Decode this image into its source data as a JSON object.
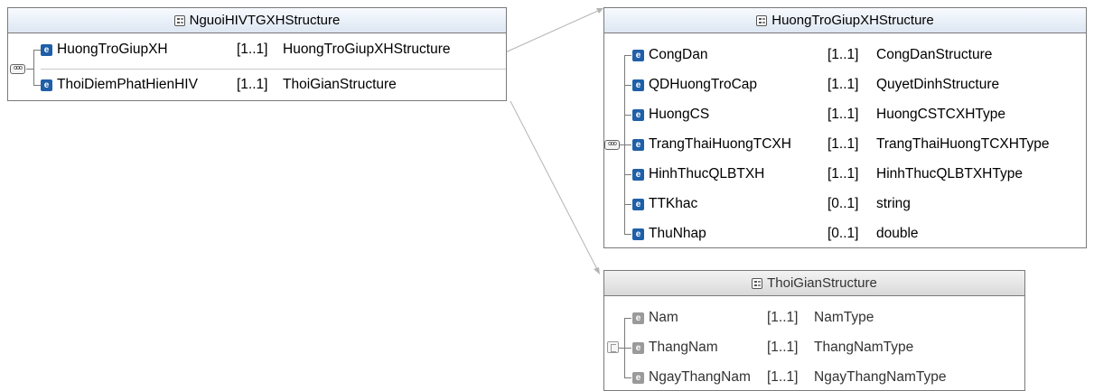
{
  "structures": {
    "nguoi": {
      "title": "NguoiHIVTGXHStructure",
      "rows": [
        {
          "name": "HuongTroGiupXH",
          "card": "[1..1]",
          "type": "HuongTroGiupXHStructure"
        },
        {
          "name": "ThoiDiemPhatHienHIV",
          "card": "[1..1]",
          "type": "ThoiGianStructure"
        }
      ]
    },
    "huong": {
      "title": "HuongTroGiupXHStructure",
      "rows": [
        {
          "name": "CongDan",
          "card": "[1..1]",
          "type": "CongDanStructure"
        },
        {
          "name": "QDHuongTroCap",
          "card": "[1..1]",
          "type": "QuyetDinhStructure"
        },
        {
          "name": "HuongCS",
          "card": "[1..1]",
          "type": "HuongCSTCXHType"
        },
        {
          "name": "TrangThaiHuongTCXH",
          "card": "[1..1]",
          "type": "TrangThaiHuongTCXHType"
        },
        {
          "name": "HinhThucQLBTXH",
          "card": "[1..1]",
          "type": "HinhThucQLBTXHType"
        },
        {
          "name": "TTKhac",
          "card": "[0..1]",
          "type": "string"
        },
        {
          "name": "ThuNhap",
          "card": "[0..1]",
          "type": "double"
        }
      ]
    },
    "thoigian": {
      "title": "ThoiGianStructure",
      "rows": [
        {
          "name": "Nam",
          "card": "[1..1]",
          "type": "NamType"
        },
        {
          "name": "ThangNam",
          "card": "[1..1]",
          "type": "ThangNamType"
        },
        {
          "name": "NgayThangNam",
          "card": "[1..1]",
          "type": "NgayThangNamType"
        }
      ]
    }
  },
  "icons": {
    "element": "e",
    "sequence": "ooo"
  },
  "colors": {
    "element_icon": "#1f5fa8",
    "element_icon_dim": "#9a9a9a",
    "border": "#7a7a7a",
    "connector": "#b4b4b4"
  }
}
